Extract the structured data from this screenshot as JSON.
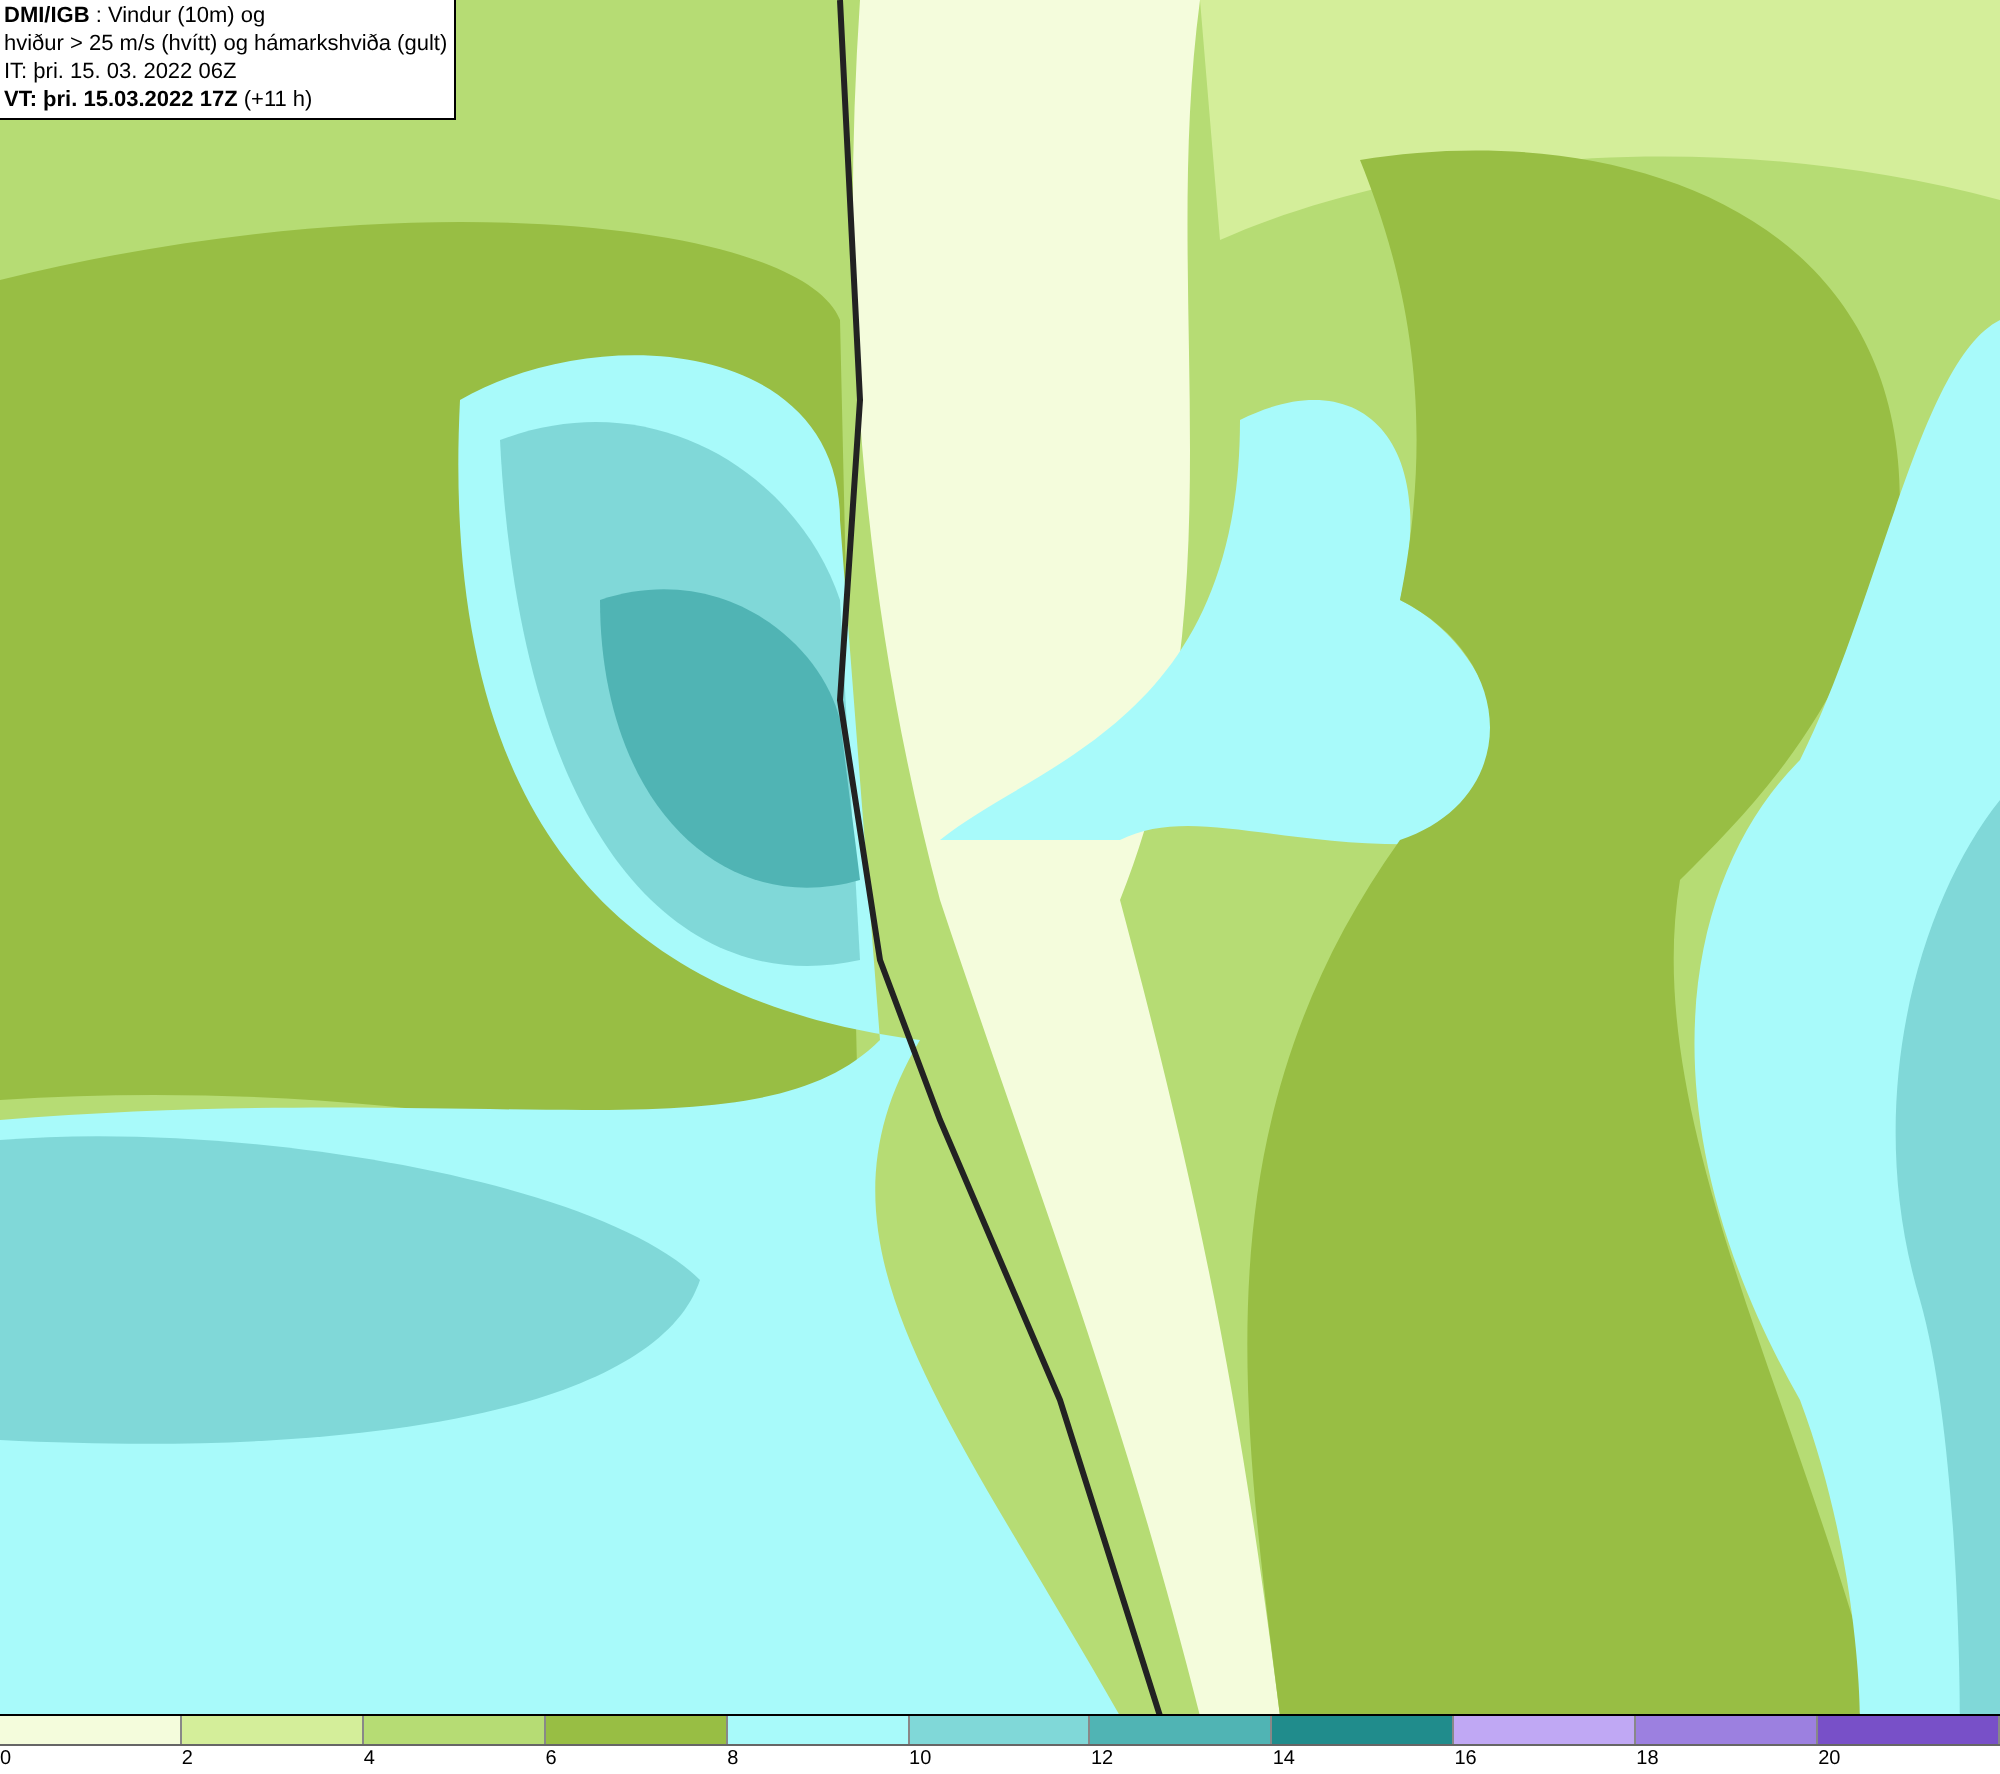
{
  "header": {
    "lines": [
      "**DMI/IGB** : Vindur (10m) og",
      "hviður > 25 m/s (hvítt) og hámarkshviða (gult)",
      "IT: þri. 15. 03. 2022 06Z",
      "**VT: þri. 15.03.2022 17Z** (+11 h)"
    ]
  },
  "legend": {
    "segments": [
      {
        "color": "#f4fcdc"
      },
      {
        "color": "#d4ee9a"
      },
      {
        "color": "#b6dc74"
      },
      {
        "color": "#98be44"
      },
      {
        "color": "#a8fafa"
      },
      {
        "color": "#80d8d8"
      },
      {
        "color": "#50b4b4"
      },
      {
        "color": "#208c8c"
      },
      {
        "color": "#c0a8f4"
      },
      {
        "color": "#9c80e0"
      },
      {
        "color": "#7850c8"
      }
    ],
    "labels": [
      "0",
      "2",
      "4",
      "6",
      "8",
      "10",
      "12",
      "14",
      "16",
      "18",
      "20"
    ]
  }
}
